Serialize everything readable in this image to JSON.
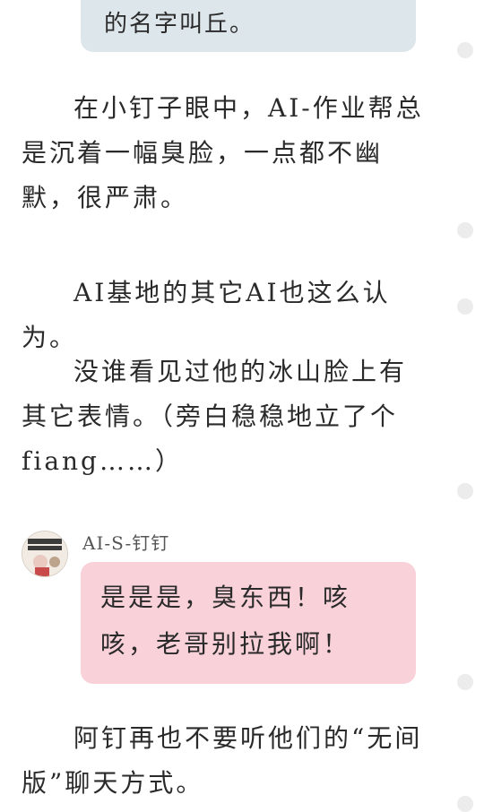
{
  "top_bubble": {
    "text": "的名字叫丘。"
  },
  "paragraphs": {
    "p1": "在小钉子眼中，AI-作业帮总是沉着一幅臭脸，一点都不幽默，很严肃。",
    "p2": "AI基地的其它AI也这么认为。",
    "p3": "没谁看见过他的冰山脸上有其它表情。（旁白稳稳地立了个fiang……）",
    "p4": "阿钉再也不要听他们的“无间版”聊天方式。"
  },
  "message": {
    "username": "AI-S-钉钉",
    "text": "是是是，臭东西！咳咳，老哥别拉我啊！",
    "avatar_icon": "avatar-icon"
  },
  "colors": {
    "top_bubble_bg": "#dde6eb",
    "pink_bubble_bg": "#f8d1d9"
  }
}
